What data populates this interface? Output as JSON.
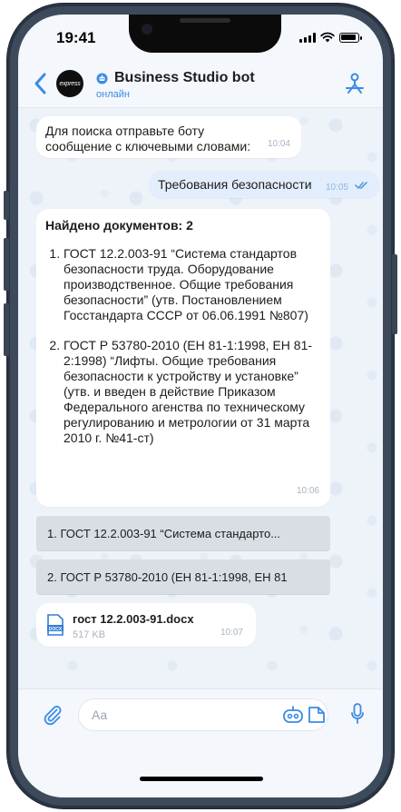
{
  "status_bar": {
    "time": "19:41"
  },
  "header": {
    "avatar_text": "express",
    "title": "Business Studio bot",
    "status": "онлайн"
  },
  "messages": {
    "intro": {
      "text": "Для поиска отправьте боту сообщение с ключевыми словами:",
      "time": "10:04"
    },
    "query": {
      "text": "Требования безопасности",
      "time": "10:05"
    },
    "results": {
      "heading": "Найдено документов: 2",
      "items": [
        "ГОСТ 12.2.003-91 “Система стандартов безопасности труда. Оборудование производственное. Общие требования безопасности” (утв. Постановлением Госстандарта СССР от 06.06.1991 №807)",
        "ГОСТ Р 53780-2010 (ЕН 81-1:1998, ЕН 81-2:1998) “Лифты. Общие требования безопасности к устройству и установке” (утв. и введен в действие Приказом Федерального агенства по техническому регулированию и метрологии от 31 марта 2010 г. №41-ст)"
      ],
      "time": "10:06"
    }
  },
  "keyboard_buttons": [
    "1. ГОСТ 12.2.003-91 “Система стандарто...",
    "2. ГОСТ Р 53780-2010 (ЕН 81-1:1998, ЕН 81"
  ],
  "file_message": {
    "icon_label": "DOCX",
    "name": "гост 12.2.003-91.docx",
    "size": "517 KB",
    "time": "10:07"
  },
  "composer": {
    "placeholder": "Aa"
  },
  "colors": {
    "accent": "#3a8be6",
    "bubble": "#ffffff",
    "outgoing_bubble": "#e3eefc"
  }
}
